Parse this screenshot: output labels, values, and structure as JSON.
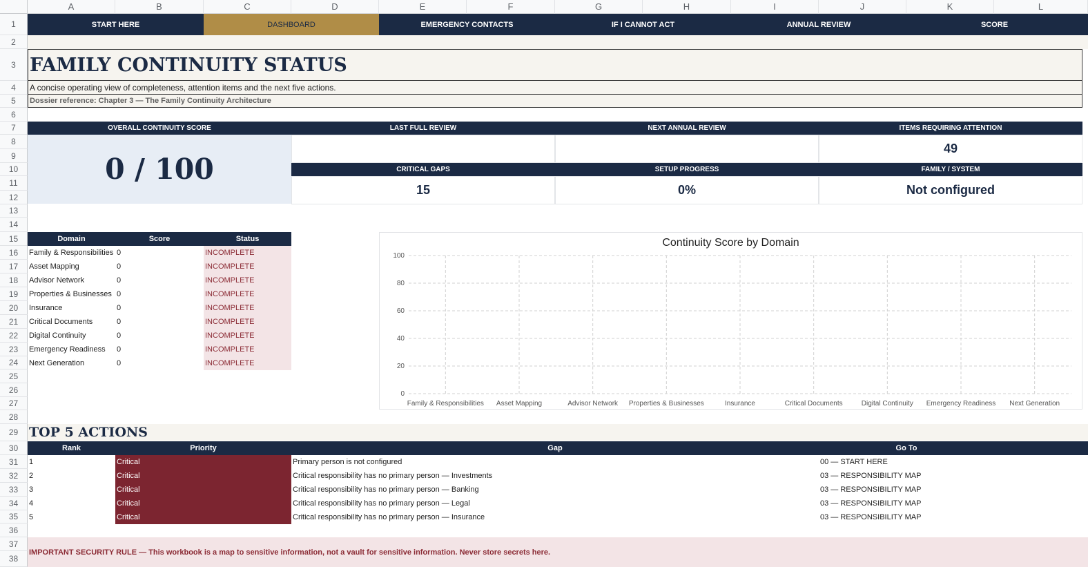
{
  "columns": [
    "A",
    "B",
    "C",
    "D",
    "E",
    "F",
    "G",
    "H",
    "I",
    "J",
    "K",
    "L"
  ],
  "rows": [
    "1",
    "2",
    "3",
    "4",
    "5",
    "6",
    "7",
    "8",
    "9",
    "10",
    "11",
    "12",
    "13",
    "14",
    "15",
    "16",
    "17",
    "18",
    "19",
    "20",
    "21",
    "22",
    "23",
    "24",
    "25",
    "26",
    "27",
    "28",
    "29",
    "30",
    "31",
    "32",
    "33",
    "34",
    "35",
    "36",
    "37",
    "38"
  ],
  "nav": {
    "items": [
      "START HERE",
      "DASHBOARD",
      "EMERGENCY CONTACTS",
      "IF I CANNOT ACT",
      "ANNUAL REVIEW",
      "SCORE"
    ],
    "active": "DASHBOARD"
  },
  "header": {
    "title": "FAMILY CONTINUITY STATUS",
    "subtitle": "A concise operating view of completeness, attention items and the next five actions.",
    "reference": "Dossier reference: Chapter 3 — The Family Continuity Architecture"
  },
  "cards": {
    "overall_label": "OVERALL CONTINUITY SCORE",
    "overall_value": "0 / 100",
    "last_review_label": "LAST FULL REVIEW",
    "last_review_value": "",
    "next_review_label": "NEXT ANNUAL REVIEW",
    "next_review_value": "",
    "attention_label": "ITEMS REQUIRING ATTENTION",
    "attention_value": "49",
    "critical_label": "CRITICAL GAPS",
    "critical_value": "15",
    "progress_label": "SETUP PROGRESS",
    "progress_value": "0%",
    "family_label": "FAMILY / SYSTEM",
    "family_value": "Not configured"
  },
  "domain_table": {
    "headers": [
      "Domain",
      "Score",
      "Status"
    ],
    "rows": [
      {
        "domain": "Family & Responsibilities",
        "score": "0",
        "status": "INCOMPLETE"
      },
      {
        "domain": "Asset Mapping",
        "score": "0",
        "status": "INCOMPLETE"
      },
      {
        "domain": "Advisor Network",
        "score": "0",
        "status": "INCOMPLETE"
      },
      {
        "domain": "Properties & Businesses",
        "score": "0",
        "status": "INCOMPLETE"
      },
      {
        "domain": "Insurance",
        "score": "0",
        "status": "INCOMPLETE"
      },
      {
        "domain": "Critical Documents",
        "score": "0",
        "status": "INCOMPLETE"
      },
      {
        "domain": "Digital Continuity",
        "score": "0",
        "status": "INCOMPLETE"
      },
      {
        "domain": "Emergency Readiness",
        "score": "0",
        "status": "INCOMPLETE"
      },
      {
        "domain": "Next Generation",
        "score": "0",
        "status": "INCOMPLETE"
      }
    ]
  },
  "chart_data": {
    "type": "bar",
    "title": "Continuity Score by Domain",
    "categories": [
      "Family & Responsibilities",
      "Asset Mapping",
      "Advisor Network",
      "Properties & Businesses",
      "Insurance",
      "Critical Documents",
      "Digital Continuity",
      "Emergency Readiness",
      "Next Generation"
    ],
    "values": [
      0,
      0,
      0,
      0,
      0,
      0,
      0,
      0,
      0
    ],
    "ylim": [
      0,
      100
    ],
    "yticks": [
      "0",
      "20",
      "40",
      "60",
      "80",
      "100"
    ],
    "grid": true,
    "xlabel": "",
    "ylabel": ""
  },
  "actions": {
    "title": "TOP 5 ACTIONS",
    "headers": [
      "Rank",
      "Priority",
      "Gap",
      "Go To"
    ],
    "rows": [
      {
        "rank": "1",
        "priority": "Critical",
        "gap": "Primary person is not configured",
        "goto": "00 — START HERE"
      },
      {
        "rank": "2",
        "priority": "Critical",
        "gap": "Critical responsibility has no primary person — Investments",
        "goto": "03 — RESPONSIBILITY MAP"
      },
      {
        "rank": "3",
        "priority": "Critical",
        "gap": "Critical responsibility has no primary person — Banking",
        "goto": "03 — RESPONSIBILITY MAP"
      },
      {
        "rank": "4",
        "priority": "Critical",
        "gap": "Critical responsibility has no primary person — Legal",
        "goto": "03 — RESPONSIBILITY MAP"
      },
      {
        "rank": "5",
        "priority": "Critical",
        "gap": "Critical responsibility has no primary person — Insurance",
        "goto": "03 — RESPONSIBILITY MAP"
      }
    ]
  },
  "security_rule": "IMPORTANT SECURITY RULE — This workbook is a map to sensitive information, not a vault for sensitive information. Never store secrets here.",
  "colors": {
    "navy": "#1b2a44",
    "gold": "#b08d47",
    "cream": "#f6f4ef",
    "critical": "#7c2530",
    "incomplete_bg": "#f3e4e6",
    "score_bg": "#e7edf5"
  }
}
